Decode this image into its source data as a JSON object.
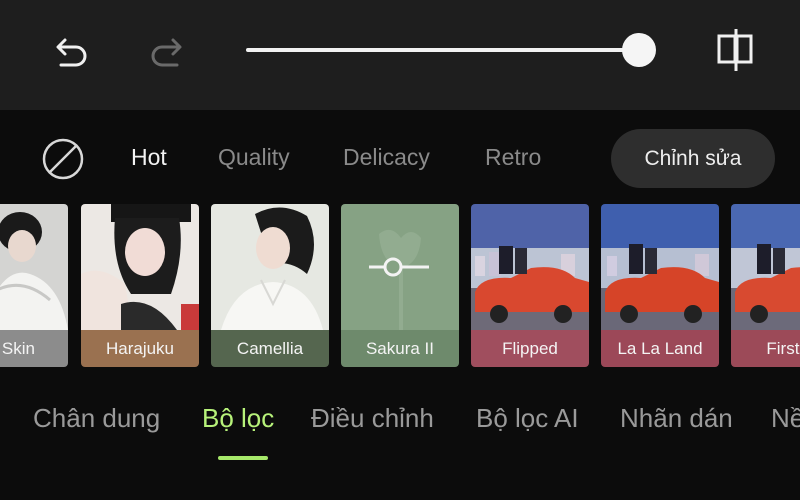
{
  "toolbar": {
    "undo_icon": "undo-icon",
    "redo_icon": "redo-icon",
    "compare_icon": "compare-icon",
    "intensity_slider_value": 1.0
  },
  "categories": {
    "none_icon": "no-filter-icon",
    "items": [
      {
        "label": "Hot",
        "active": true
      },
      {
        "label": "Quality"
      },
      {
        "label": "Delicacy"
      },
      {
        "label": "Retro"
      }
    ],
    "edit_button_label": "Chỉnh sửa"
  },
  "filters": [
    {
      "label": "nt Skin",
      "label_color": "#8c8c8c"
    },
    {
      "label": "Harajuku",
      "label_color": "#9a7150"
    },
    {
      "label": "Camellia",
      "label_color": "#55664f"
    },
    {
      "label": "Sakura  II",
      "label_color": "#6e8a6c",
      "selected": true,
      "selected_icon": "adjust-slider-icon"
    },
    {
      "label": "Flipped",
      "label_color": "#a04e5e"
    },
    {
      "label": "La La Land",
      "label_color": "#9c4858"
    },
    {
      "label": "First L",
      "label_color": "#9c4a58"
    }
  ],
  "tabs": {
    "items": [
      {
        "label": "Chân dung"
      },
      {
        "label": "Bộ lọc",
        "active": true
      },
      {
        "label": "Điều chỉnh"
      },
      {
        "label": "Bộ lọc AI"
      },
      {
        "label": "Nhãn dán"
      },
      {
        "label": "Nề"
      }
    ]
  },
  "colors": {
    "accent": "#a6e86a",
    "toolbar_bg": "#1e1e1e",
    "background": "#0c0c0c"
  }
}
